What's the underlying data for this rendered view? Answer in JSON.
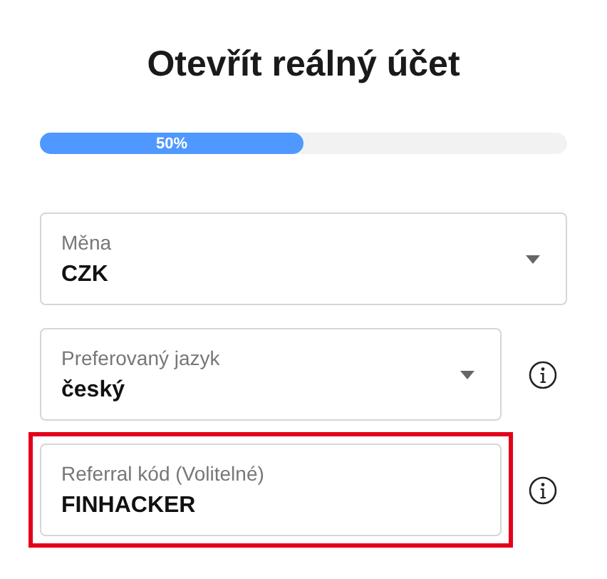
{
  "title": "Otevřít reálný účet",
  "progress": {
    "level": 0.5,
    "label": "50%"
  },
  "fields": [
    {
      "kind": "select",
      "label": "Měna",
      "value": "CZK",
      "info": false,
      "highlighted": false
    },
    {
      "kind": "select",
      "label": "Preferovaný jazyk",
      "value": "český",
      "info": true,
      "highlighted": false
    },
    {
      "kind": "text",
      "label": "Referral kód (Volitelné)",
      "value": "FINHACKER",
      "info": true,
      "highlighted": true
    }
  ]
}
